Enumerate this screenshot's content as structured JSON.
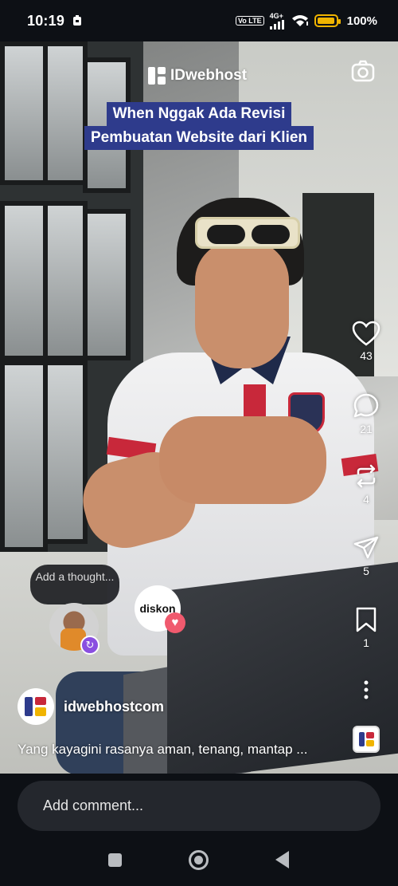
{
  "status_bar": {
    "time": "10:19",
    "volte": "Vo LTE",
    "network": "4G+",
    "battery": "100%"
  },
  "video_overlay": {
    "brand": "IDwebhost",
    "caption_line1": "When Nggak Ada Revisi",
    "caption_line2": "Pembuatan Website dari Klien"
  },
  "actions": {
    "likes": "43",
    "comments": "21",
    "reposts": "4",
    "shares": "5",
    "saves": "1"
  },
  "thought_bubble": {
    "text": "Add a thought..."
  },
  "diskon_sticker": {
    "text": "diskon"
  },
  "post": {
    "username": "idwebhostcom",
    "caption": "Yang kayagini rasanya aman, tenang, mantap ..."
  },
  "comment_bar": {
    "placeholder": "Add comment..."
  },
  "colors": {
    "caption_bg": "#2e3b8c",
    "brand_red": "#c8283a",
    "battery": "#f0b400"
  }
}
